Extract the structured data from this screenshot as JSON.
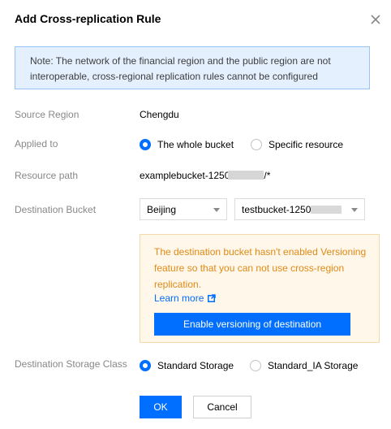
{
  "dialog": {
    "title": "Add Cross-replication Rule",
    "close_icon": "close-icon"
  },
  "note": {
    "text": "Note: The network of the financial region and the public region are not interoperable, cross-regional replication rules cannot be configured"
  },
  "form": {
    "source_region": {
      "label": "Source Region",
      "value": "Chengdu"
    },
    "applied_to": {
      "label": "Applied to",
      "options": [
        "The whole bucket",
        "Specific resource"
      ],
      "selected": "The whole bucket"
    },
    "resource_path": {
      "label": "Resource path",
      "value_prefix": "examplebucket-1250",
      "value_suffix": "/*"
    },
    "destination_bucket": {
      "label": "Destination Bucket",
      "region": "Beijing",
      "bucket_prefix": "testbucket-1250"
    },
    "warning": {
      "text": "The destination bucket hasn't enabled Versioning feature so that you can not use cross-region replication.",
      "learn_more": "Learn more",
      "enable_button": "Enable versioning of destination"
    },
    "storage_class": {
      "label": "Destination Storage Class",
      "options": [
        "Standard Storage",
        "Standard_IA Storage"
      ],
      "selected": "Standard Storage"
    }
  },
  "footer": {
    "ok": "OK",
    "cancel": "Cancel"
  },
  "colors": {
    "primary": "#006eff",
    "note_bg": "#e5f0ff",
    "warning_bg": "#fff7ea",
    "warning_text": "#e08a16"
  }
}
